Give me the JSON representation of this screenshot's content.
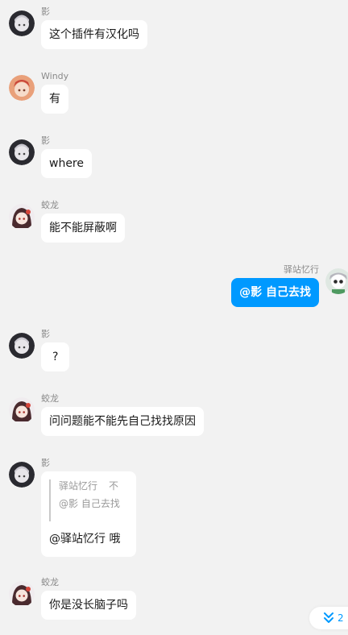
{
  "colors": {
    "background": "#f2f2f2",
    "bubble": "#ffffff",
    "own_bubble": "#0099ff",
    "accent": "#0099ff"
  },
  "messages": [
    {
      "sender": "影",
      "text": "这个插件有汉化吗",
      "side": "left",
      "avatar": "ying-avatar"
    },
    {
      "sender": "Windy",
      "text": "有",
      "side": "left",
      "avatar": "windy-avatar"
    },
    {
      "sender": "影",
      "text": "where",
      "side": "left",
      "avatar": "ying-avatar"
    },
    {
      "sender": "蛟龙",
      "text": "能不能屏蔽啊",
      "side": "left",
      "avatar": "jiaolong-avatar"
    },
    {
      "sender": "驿站忆行",
      "text": "@影 自己去找",
      "side": "right",
      "avatar": "yizhan-avatar"
    },
    {
      "sender": "影",
      "text": "?",
      "side": "left",
      "avatar": "ying-avatar"
    },
    {
      "sender": "蛟龙",
      "text": "问问题能不能先自己找找原因",
      "side": "left",
      "avatar": "jiaolong-avatar"
    },
    {
      "sender": "影",
      "side": "left",
      "avatar": "ying-avatar",
      "quote": {
        "author": "驿站忆行",
        "suffix": "不",
        "text": "@影 自己去找"
      },
      "text": "@驿站忆行 哦"
    },
    {
      "sender": "蛟龙",
      "text": "你是没长脑子吗",
      "side": "left",
      "avatar": "jiaolong-avatar"
    }
  ],
  "scroll_to_bottom": {
    "icon": "double-chevron-down-icon",
    "count": "2"
  }
}
